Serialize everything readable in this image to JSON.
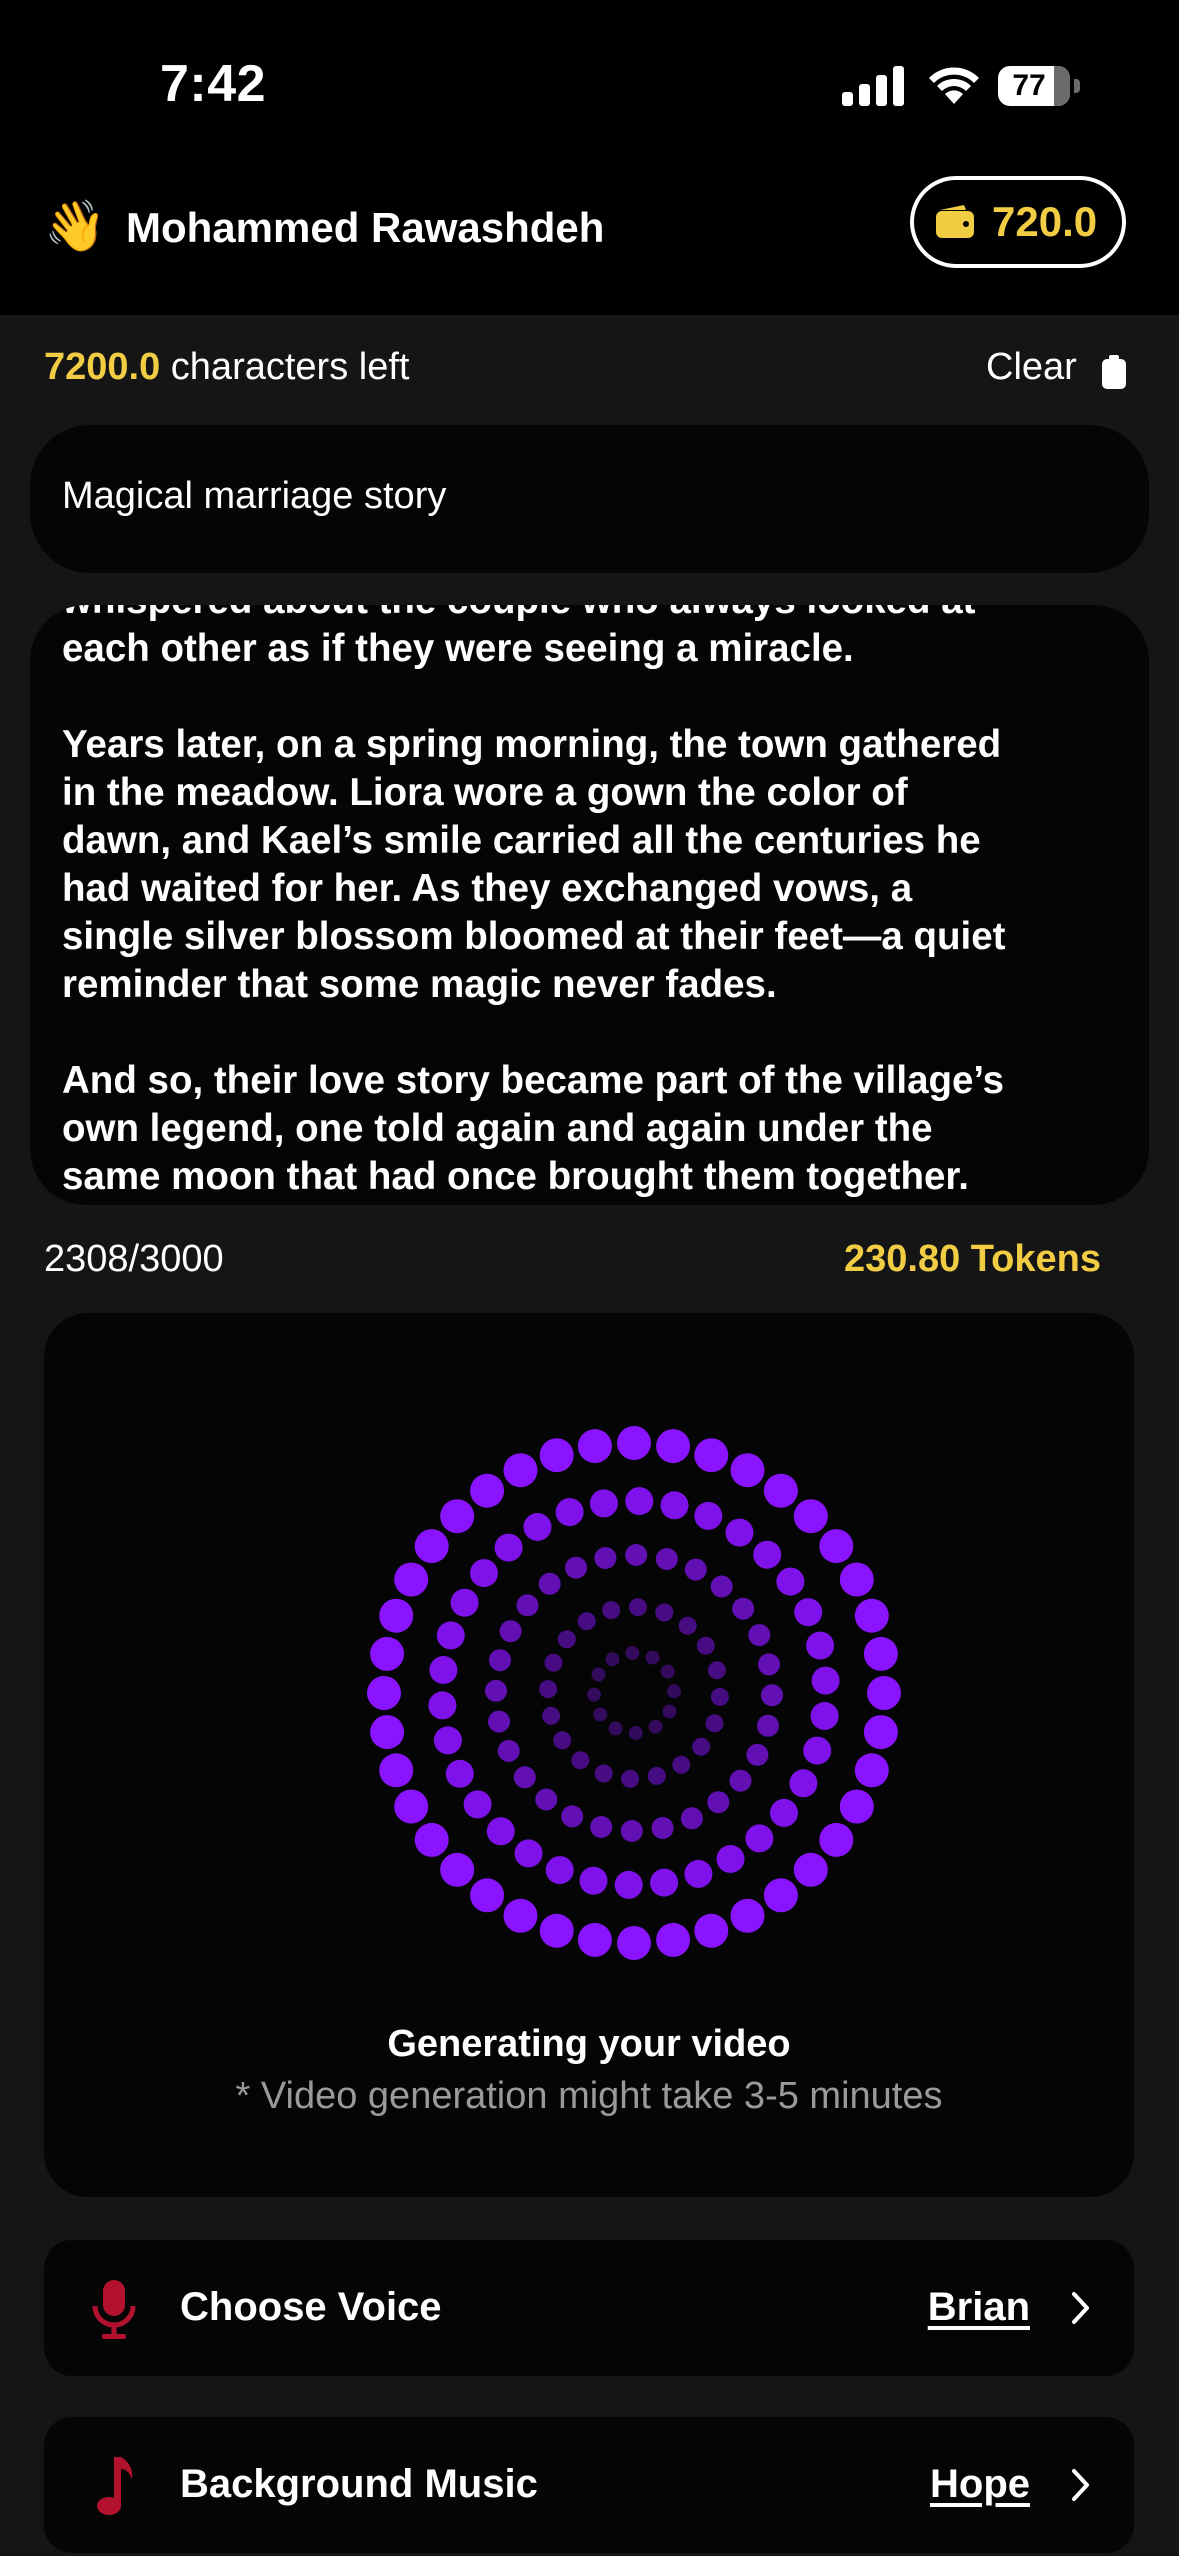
{
  "status_bar": {
    "time": "7:42",
    "battery": "77"
  },
  "header": {
    "wave_emoji": "👋",
    "user_name": "Mohammed Rawashdeh",
    "wallet_amount": "720.0",
    "wallet_icon": "wallet-icon"
  },
  "editor": {
    "characters_left_value": "7200.0",
    "characters_left_label": "characters left",
    "clear_label": "Clear",
    "title": "Magical marriage story",
    "story_paragraphs": [
      "whispered about the couple who always looked at\neach other as if they were seeing a miracle.",
      "Years later, on a spring morning, the town gathered\nin the meadow. Liora wore a gown the color of\ndawn, and Kael’s smile carried all the centuries he\nhad waited for her. As they exchanged vows, a\nsingle silver blossom bloomed at their feet—a quiet\nreminder that some magic never fades.",
      "And so, their love story became part of the village’s\nown legend, one told again and again under the\nsame moon that had once brought them together."
    ],
    "count": "2308/3000",
    "tokens": "230.80 Tokens"
  },
  "generation": {
    "title": "Generating your video",
    "subtitle": "* Video generation might take 3-5 minutes"
  },
  "options": [
    {
      "label": "Choose Voice",
      "value": "Brian",
      "icon": "microphone-icon"
    },
    {
      "label": "Background Music",
      "value": "Hope",
      "icon": "music-note-icon"
    }
  ],
  "colors": {
    "accent_yellow": "#f2cd44",
    "spinner_purple": "#8a14ff",
    "icon_red": "#b3122e"
  }
}
